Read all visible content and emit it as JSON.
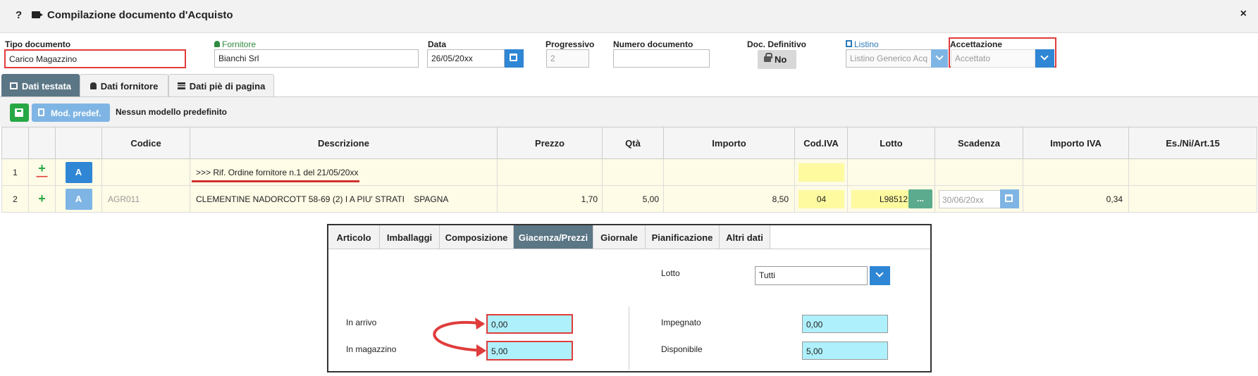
{
  "title": {
    "help": "?",
    "text": "Compilazione documento d'Acquisto",
    "close": "×"
  },
  "header": {
    "tipo_documento": {
      "label": "Tipo documento",
      "value": "Carico Magazzino"
    },
    "fornitore": {
      "label": "Fornitore",
      "value": "Bianchi Srl"
    },
    "data": {
      "label": "Data",
      "value": "26/05/20xx"
    },
    "progressivo": {
      "label": "Progressivo",
      "value": "2"
    },
    "numero_documento": {
      "label": "Numero documento",
      "value": ""
    },
    "doc_definitivo": {
      "label": "Doc. Definitivo",
      "value": "No"
    },
    "listino": {
      "label": "Listino",
      "value": "Listino Generico Acq"
    },
    "accettazione": {
      "label": "Accettazione",
      "value": "Accettato"
    }
  },
  "tabs": [
    "Dati testata",
    "Dati fornitore",
    "Dati piè di pagina"
  ],
  "toolbar": {
    "mod_predef": "Mod. predef.",
    "nessun_modello": "Nessun modello predefinito"
  },
  "grid": {
    "columns": [
      "",
      "",
      "",
      "Codice",
      "Descrizione",
      "Prezzo",
      "Qtà",
      "Importo",
      "Cod.IVA",
      "Lotto",
      "Scadenza",
      "Importo IVA",
      "Es./Ni/Art.15"
    ],
    "rows": [
      {
        "num": "1",
        "btn": "A",
        "codice": "",
        "descrizione": ">>> Rif. Ordine fornitore n.1 del 21/05/20xx",
        "prezzo": "",
        "qta": "",
        "importo": "",
        "cod_iva": "",
        "lotto": "",
        "scadenza": "",
        "importo_iva": "",
        "es": ""
      },
      {
        "num": "2",
        "btn": "A",
        "codice": "AGR011",
        "descrizione": "CLEMENTINE NADORCOTT 58-69 (2) I A PIU' STRATI    SPAGNA",
        "prezzo": "1,70",
        "qta": "5,00",
        "importo": "8,50",
        "cod_iva": "04",
        "lotto": "L98512",
        "lotto_btn": "...",
        "scadenza": "30/06/20xx",
        "importo_iva": "0,34",
        "es": ""
      }
    ]
  },
  "panel": {
    "tabs": [
      "Articolo",
      "Imballaggi",
      "Composizione",
      "Giacenza/Prezzi",
      "Giornale",
      "Pianificazione",
      "Altri dati"
    ],
    "lotto": {
      "label": "Lotto",
      "value": "Tutti"
    },
    "in_arrivo": {
      "label": "In arrivo",
      "value": "0,00"
    },
    "in_magazzino": {
      "label": "In magazzino",
      "value": "5,00"
    },
    "impegnato": {
      "label": "Impegnato",
      "value": "0,00"
    },
    "disponibile": {
      "label": "Disponibile",
      "value": "5,00"
    }
  },
  "colors": {
    "accent": "#2f86d4",
    "active_tab": "#5b7685",
    "highlight_red": "#e03c3c",
    "cyan_field": "#aef0fb",
    "row_yellow": "#fefbe6"
  }
}
